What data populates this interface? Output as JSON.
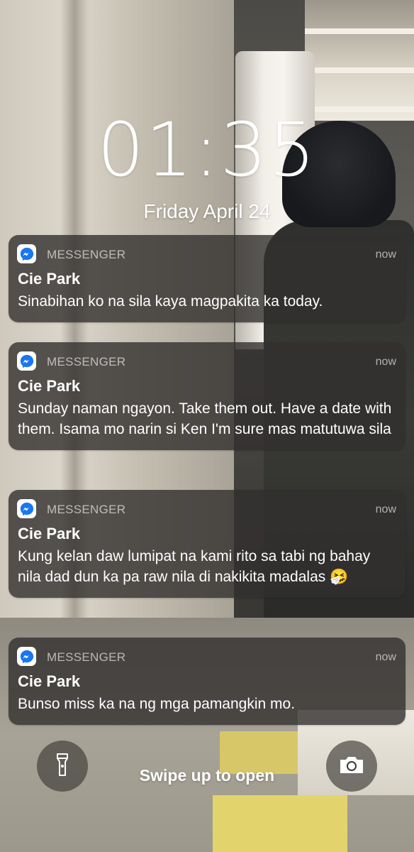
{
  "lockscreen": {
    "time": "01:35",
    "date": "Friday April 24"
  },
  "notifications": [
    {
      "app": "MESSENGER",
      "time": "now",
      "sender": "Cie Park",
      "message": "Sinabihan ko na sila kaya magpakita ka today."
    },
    {
      "app": "MESSENGER",
      "time": "now",
      "sender": "Cie Park",
      "message": "Sunday naman ngayon. Take them out. Have a date with them. Isama mo narin si Ken I'm sure mas matutuwa sila"
    },
    {
      "app": "MESSENGER",
      "time": "now",
      "sender": "Cie Park",
      "message": "Kung kelan daw lumipat na kami rito sa tabi ng bahay nila dad dun ka pa raw nila di nakikita madalas 🤧"
    },
    {
      "app": "MESSENGER",
      "time": "now",
      "sender": "Cie Park",
      "message": "Bunso miss ka na ng mga pamangkin mo."
    }
  ],
  "bottom": {
    "swipe_text": "Swipe up to open",
    "left_icon": "flashlight-icon",
    "right_icon": "camera-icon"
  },
  "colors": {
    "messenger_blue": "#1877f2",
    "card_bg": "#32302e"
  }
}
